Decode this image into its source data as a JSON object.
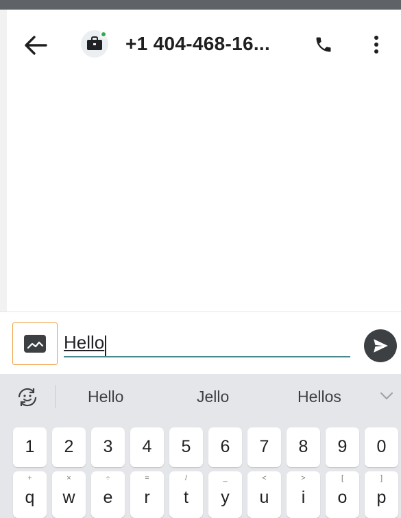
{
  "header": {
    "title": "+1 404-468-16...",
    "back_icon": "arrow-left-icon",
    "avatar_icon": "briefcase-icon",
    "call_icon": "phone-icon",
    "more_icon": "more-vert-icon",
    "status_color": "#34a853"
  },
  "compose": {
    "attach_icon": "image-icon",
    "input_value": "Hello",
    "send_icon": "send-icon",
    "accent": "#4b8a8c"
  },
  "keyboard": {
    "suggestions": [
      "Hello",
      "Jello",
      "Hellos"
    ],
    "number_row": [
      "1",
      "2",
      "3",
      "4",
      "5",
      "6",
      "7",
      "8",
      "9",
      "0"
    ],
    "letter_row": [
      {
        "key": "q",
        "alt": "+"
      },
      {
        "key": "w",
        "alt": "×"
      },
      {
        "key": "e",
        "alt": "÷"
      },
      {
        "key": "r",
        "alt": "="
      },
      {
        "key": "t",
        "alt": "/"
      },
      {
        "key": "y",
        "alt": "_"
      },
      {
        "key": "u",
        "alt": "<"
      },
      {
        "key": "i",
        "alt": ">"
      },
      {
        "key": "o",
        "alt": "["
      },
      {
        "key": "p",
        "alt": "]"
      }
    ]
  }
}
